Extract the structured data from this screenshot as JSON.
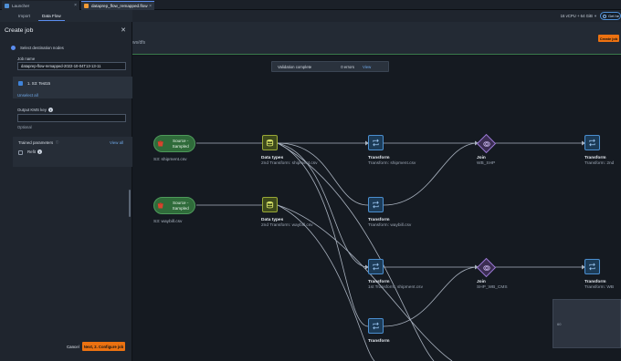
{
  "window_tabs": [
    {
      "label": "Launcher"
    },
    {
      "label": "dataprep_flow_remapped.flow"
    }
  ],
  "sub_tabs": [
    {
      "label": "Import"
    },
    {
      "label": "Data Flow"
    }
  ],
  "resource": {
    "label": "16 vCPU + 64 GiB"
  },
  "get_help": {
    "label": "Get he"
  },
  "header": {
    "tab_label": "ws/dfs",
    "create_job_label": "Create job"
  },
  "validation": {
    "status": "Validation complete",
    "errors": "0 errors",
    "link": "View"
  },
  "panel": {
    "title": "Create job",
    "step": "Select destination nodes",
    "job_name_label": "Job name",
    "job_name_value": "dataprep-flow-remapped-2022-10-04T13-13-11",
    "selected_node": "1. S3: Test15",
    "unselect_all": "Unselect all",
    "kms_label": "Output KMS key",
    "kms_value": "",
    "optional": "Optional",
    "trained_params_title": "Trained parameters",
    "view_all": "View all",
    "refit_label": "Refit",
    "cancel": "Cancel",
    "next": "Next, 2. Configure job"
  },
  "nodes": {
    "source1": {
      "pill": "Source - Sampled",
      "label": "S3: shipment.csv"
    },
    "source2": {
      "pill": "Source - Sampled",
      "label": "S3: waybill.csv"
    },
    "types1": {
      "title": "Data types",
      "sub": "2nd Transform: shipment.csv"
    },
    "types2": {
      "title": "Data types",
      "sub": "2nd Transform: waybill.csv"
    },
    "xf1": {
      "title": "Transform",
      "sub": "Transform: shipment.csv"
    },
    "xf2": {
      "title": "Transform",
      "sub": "Transform: waybill.csv"
    },
    "xf3": {
      "title": "Transform",
      "sub": "1st Transform: shipment.csv"
    },
    "xf4": {
      "title": "Transform",
      "sub": ""
    },
    "join1": {
      "title": "Join",
      "sub": "WB_SHP"
    },
    "join2": {
      "title": "Join",
      "sub": "SHP_WB_CMS"
    },
    "xf5": {
      "title": "Transform",
      "sub": "Transform: 2nd"
    },
    "xf6": {
      "title": "Transform",
      "sub": "Transform: WB"
    }
  },
  "minimap": {
    "label": "60"
  },
  "colors": {
    "accent": "#ec7211",
    "link": "#6fa8e8",
    "source": "#2f6b3a",
    "types": "#9aa937",
    "transform": "#4b8fd0",
    "join": "#9b7ad6"
  }
}
